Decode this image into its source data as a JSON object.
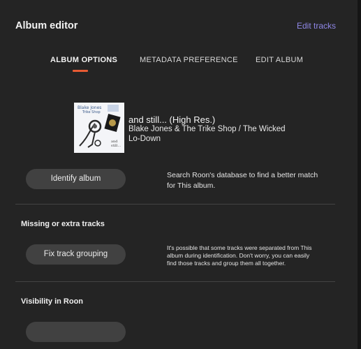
{
  "window": {
    "title": "Album editor",
    "edit_tracks_label": "Edit tracks"
  },
  "tabs": [
    {
      "label": "ALBUM OPTIONS",
      "active": true
    },
    {
      "label": "METADATA PREFERENCE",
      "active": false
    },
    {
      "label": "EDIT ALBUM",
      "active": false
    }
  ],
  "album": {
    "title": "and still... (High Res.)",
    "artist_line1": "Blake Jones & The Trike Shop / The Wicked",
    "artist_line2": "Lo-Down",
    "cover_text": {
      "line1": "Blake Jones",
      "line2": "Trike Shop",
      "line3": "and still..."
    }
  },
  "identify": {
    "button_label": "Identify album",
    "description_line1": "Search Roon's database to find a better match",
    "description_line2": "for This album."
  },
  "missing_tracks": {
    "heading": "Missing or extra tracks",
    "button_label": "Fix track grouping",
    "description_line1": "It's possible that some tracks were separated from This",
    "description_line2": "album during identification. Don't worry, you can easily",
    "description_line3": "find those tracks and group them all together."
  },
  "visibility": {
    "heading": "Visibility in Roon"
  },
  "colors": {
    "accent": "#e65a33",
    "link": "#8f87e6",
    "background": "#242424",
    "button": "#414141"
  }
}
